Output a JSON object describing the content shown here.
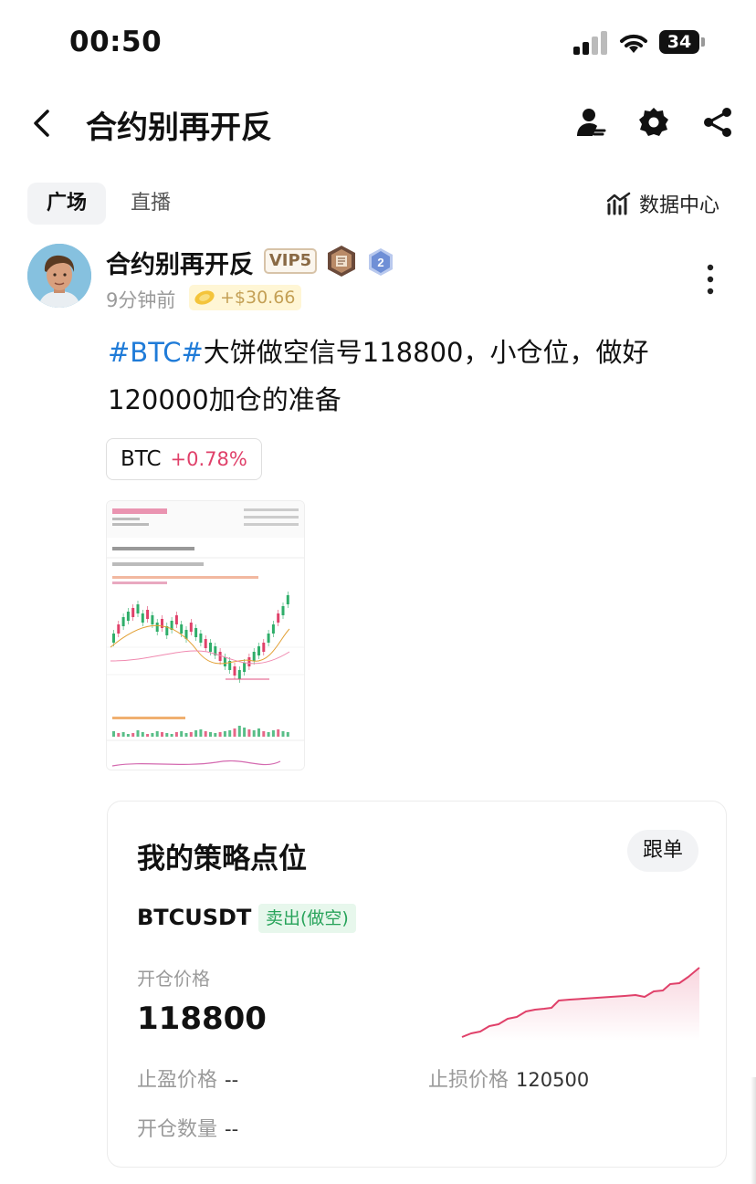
{
  "status_bar": {
    "time": "00:50",
    "battery": "34"
  },
  "header": {
    "title": "合约别再开反"
  },
  "tabs": [
    {
      "label": "广场",
      "active": true
    },
    {
      "label": "直播",
      "active": false
    }
  ],
  "data_center": {
    "label": "数据中心"
  },
  "post": {
    "author": {
      "name": "合约别再开反",
      "vip": "VIP5",
      "level": "2"
    },
    "time_ago": "9分钟前",
    "profit": "+$30.66",
    "text": {
      "hashtag": "#BTC#",
      "body": "大饼做空信号118800，小仓位，做好120000加仓的准备"
    },
    "coin_tag": {
      "name": "BTC",
      "change": "+0.78%"
    }
  },
  "strategy": {
    "title": "我的策略点位",
    "follow_label": "跟单",
    "symbol": "BTCUSDT",
    "side": "卖出(做空)",
    "entry_label": "开仓价格",
    "entry_value": "118800",
    "take_profit_label": "止盈价格",
    "take_profit_value": "--",
    "stop_loss_label": "止损价格",
    "stop_loss_value": "120500",
    "quantity_label": "开仓数量",
    "quantity_value": "--"
  },
  "colors": {
    "accent_blue": "#1f7bd8",
    "up_red": "#e0416a",
    "sell_green": "#27a35a",
    "vip_gold": "#8a6a45"
  },
  "icons": [
    "back-icon",
    "user-icon",
    "gear-icon",
    "share-icon",
    "chart-icon",
    "more-vertical-icon",
    "coin-icon"
  ]
}
